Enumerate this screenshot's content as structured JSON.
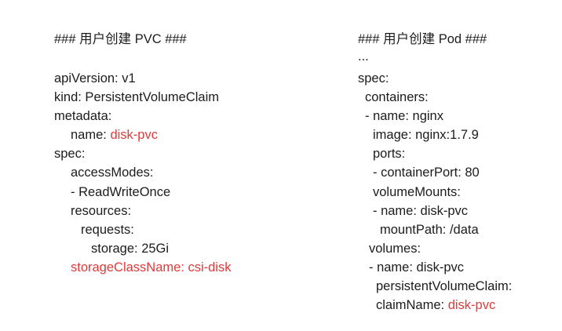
{
  "pvc": {
    "title": "### 用户创建 PVC ###",
    "api_version": "apiVersion: v1",
    "kind": "kind: PersistentVolumeClaim",
    "metadata": "metadata:",
    "name_key": "name: ",
    "name_value": "disk-pvc",
    "spec": "spec:",
    "access_modes": "accessModes:",
    "access_mode_item": "- ReadWriteOnce",
    "resources": "resources:",
    "requests": "requests:",
    "storage": "storage: 25Gi",
    "storage_class": "storageClassName: csi-disk"
  },
  "pod": {
    "title": "### 用户创建 Pod ###",
    "ellipsis": "...",
    "spec": "spec:",
    "containers": "containers:",
    "container_name": "- name: nginx",
    "image": "image: nginx:1.7.9",
    "ports": "ports:",
    "container_port": "- containerPort: 80",
    "volume_mounts": "volumeMounts:",
    "mount_name": "- name: disk-pvc",
    "mount_path": "mountPath: /data",
    "volumes": "volumes:",
    "volume_name": "- name: disk-pvc",
    "pvc_key": "persistentVolumeClaim:",
    "claim_name_key": "claimName: ",
    "claim_name_value": "disk-pvc"
  },
  "colors": {
    "highlight": "#e03a3a",
    "text": "#1c1c1c"
  }
}
